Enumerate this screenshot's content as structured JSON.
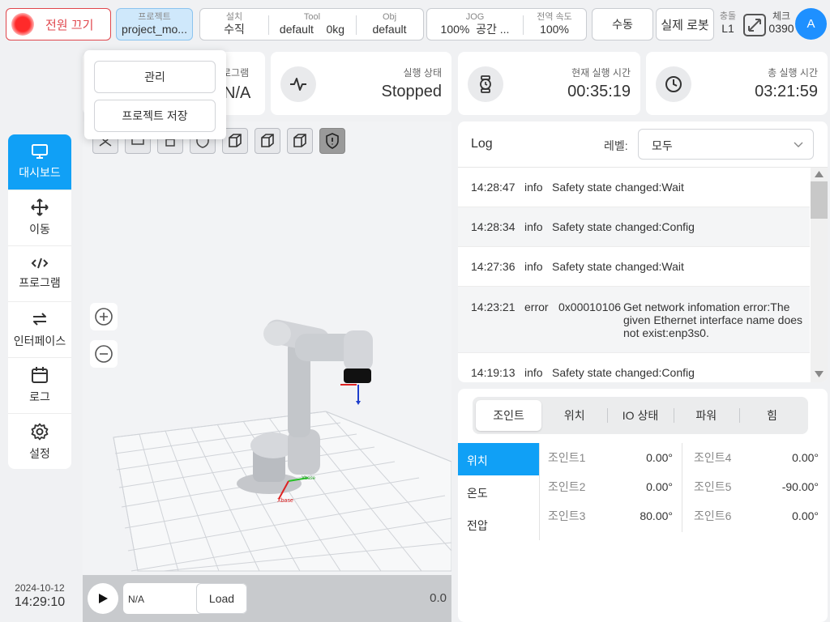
{
  "topbar": {
    "power_label": "전원 끄기",
    "project": {
      "label": "프로젝트",
      "value": "project_mo..."
    },
    "install": {
      "label": "설치",
      "value": "수직"
    },
    "tool": {
      "label": "Tool",
      "value": "default",
      "weight": "0kg"
    },
    "obj": {
      "label": "Obj",
      "value": "default"
    },
    "jog": {
      "label": "JOG",
      "value": "100%",
      "space": "공간 ..."
    },
    "global_speed": {
      "label": "전역 속도",
      "value": "100%"
    },
    "mode_label": "수동",
    "robot_label": "실제 로봇",
    "collision": {
      "label": "충돌",
      "value": "L1"
    },
    "check": {
      "label": "체크",
      "value": "0390"
    },
    "avatar": "A"
  },
  "dropdown": {
    "manage": "관리",
    "save": "프로젝트 저장"
  },
  "status": {
    "program_label_partial": "로그램",
    "program_value_partial": "N/A",
    "run_state": {
      "label": "실행 상태",
      "value": "Stopped"
    },
    "current_time": {
      "label": "현재 실행 시간",
      "value": "00:35:19"
    },
    "total_time": {
      "label": "총 실행 시간",
      "value": "03:21:59"
    }
  },
  "nav": [
    {
      "label": "대시보드",
      "icon": "monitor-icon"
    },
    {
      "label": "이동",
      "icon": "move-icon"
    },
    {
      "label": "프로그램",
      "icon": "code-icon"
    },
    {
      "label": "인터페이스",
      "icon": "swap-icon"
    },
    {
      "label": "로그",
      "icon": "calendar-icon"
    },
    {
      "label": "설정",
      "icon": "gear-icon"
    }
  ],
  "datetime": {
    "date": "2024-10-12",
    "time": "14:29:10"
  },
  "viewport": {
    "program_value": "N/A",
    "load_label": "Load",
    "speed_value": "0.0",
    "axis_x": "Xbase",
    "axis_y": "Ybase"
  },
  "log": {
    "title": "Log",
    "level_label": "레벨:",
    "level_value": "모두",
    "rows": [
      {
        "time": "14:28:47",
        "level": "info",
        "code": "",
        "msg": "Safety state changed:Wait"
      },
      {
        "time": "14:28:34",
        "level": "info",
        "code": "",
        "msg": "Safety state changed:Config"
      },
      {
        "time": "14:27:36",
        "level": "info",
        "code": "",
        "msg": "Safety state changed:Wait"
      },
      {
        "time": "14:23:21",
        "level": "error",
        "code": "0x00010106",
        "msg": "Get network infomation error:The given Ethernet interface name does not exist:enp3s0."
      },
      {
        "time": "14:19:13",
        "level": "info",
        "code": "",
        "msg": "Safety state changed:Config"
      }
    ]
  },
  "joints_panel": {
    "tabs": [
      "조인트",
      "위치",
      "IO 상태",
      "파워",
      "힘"
    ],
    "side_tabs": [
      "위치",
      "온도",
      "전압"
    ],
    "joints": [
      {
        "name": "조인트1",
        "value": "0.00°"
      },
      {
        "name": "조인트2",
        "value": "0.00°"
      },
      {
        "name": "조인트3",
        "value": "80.00°"
      },
      {
        "name": "조인트4",
        "value": "0.00°"
      },
      {
        "name": "조인트5",
        "value": "-90.00°"
      },
      {
        "name": "조인트6",
        "value": "0.00°"
      }
    ]
  },
  "colors": {
    "accent": "#10a0f6",
    "danger": "#e0464c",
    "project_bg": "#cfe8fb"
  }
}
